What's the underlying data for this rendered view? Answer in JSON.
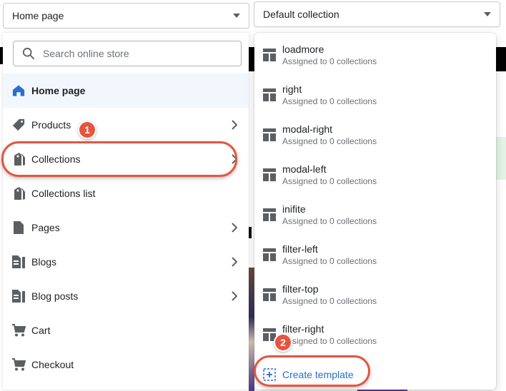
{
  "page_select": {
    "value": "Home page"
  },
  "template_select": {
    "value": "Default collection"
  },
  "search": {
    "placeholder": "Search online store"
  },
  "nav": {
    "items": [
      {
        "label": "Home page",
        "icon": "home-icon",
        "active": true,
        "has_submenu": false
      },
      {
        "label": "Products",
        "icon": "tag-icon",
        "has_submenu": true
      },
      {
        "label": "Collections",
        "icon": "tags-icon",
        "has_submenu": true
      },
      {
        "label": "Collections list",
        "icon": "tags-icon",
        "has_submenu": false
      },
      {
        "label": "Pages",
        "icon": "page-icon",
        "has_submenu": true
      },
      {
        "label": "Blogs",
        "icon": "blog-icon",
        "has_submenu": true
      },
      {
        "label": "Blog posts",
        "icon": "blog-icon",
        "has_submenu": true
      },
      {
        "label": "Cart",
        "icon": "cart-icon",
        "has_submenu": false
      },
      {
        "label": "Checkout",
        "icon": "cart-icon",
        "has_submenu": false
      }
    ]
  },
  "templates": {
    "options": [
      {
        "name": "loadmore",
        "sub": "Assigned to 0 collections"
      },
      {
        "name": "right",
        "sub": "Assigned to 0 collections"
      },
      {
        "name": "modal-right",
        "sub": "Assigned to 0 collections"
      },
      {
        "name": "modal-left",
        "sub": "Assigned to 0 collections"
      },
      {
        "name": "inifite",
        "sub": "Assigned to 0 collections"
      },
      {
        "name": "filter-left",
        "sub": "Assigned to 0 collections"
      },
      {
        "name": "filter-top",
        "sub": "Assigned to 0 collections"
      },
      {
        "name": "filter-right",
        "sub": "Assigned to 0 collections"
      }
    ],
    "create_label": "Create template"
  },
  "annotations": {
    "step1": "1",
    "step2": "2",
    "color": "#e5553f"
  },
  "colors": {
    "active_bg": "#f2f7fe",
    "link": "#2c6ecb",
    "home_icon": "#2c6ecb"
  }
}
